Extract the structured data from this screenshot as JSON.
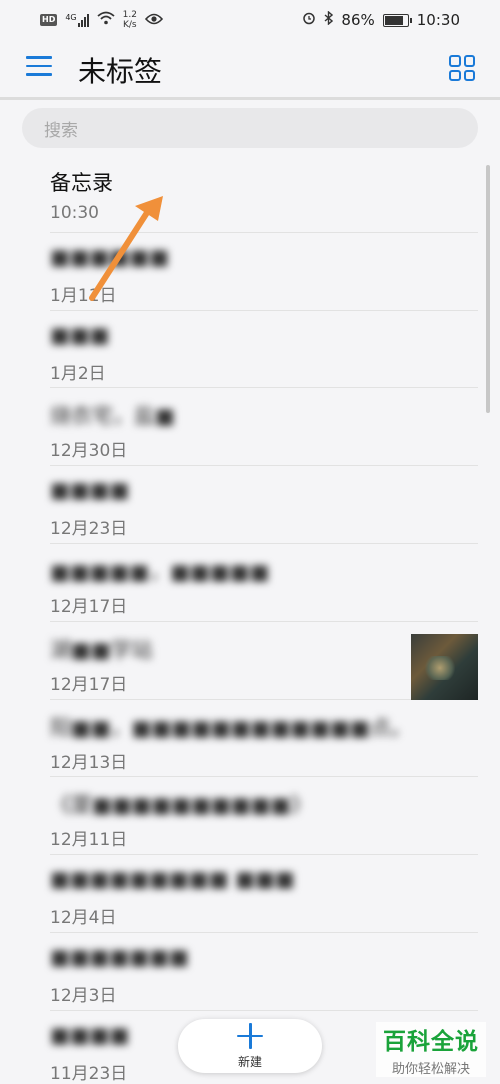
{
  "status_bar": {
    "hd": "HD",
    "signal_label": "4G",
    "net_speed_value": "1.2",
    "net_speed_unit": "K/s",
    "battery": "86%",
    "battery_level": 0.86,
    "time": "10:30"
  },
  "header": {
    "title": "未标签"
  },
  "search": {
    "placeholder": "搜索"
  },
  "notes": [
    {
      "title": "备忘录",
      "date": "10:30",
      "blurred": false,
      "has_image": false
    },
    {
      "title": "■■■■■■",
      "date": "1月11日",
      "blurred": true,
      "has_image": false
    },
    {
      "title": "■■■",
      "date": "1月2日",
      "blurred": true,
      "has_image": false
    },
    {
      "title": "烧衣宅，盐■",
      "date": "12月30日",
      "blurred": true,
      "has_image": false
    },
    {
      "title": "■■■■",
      "date": "12月23日",
      "blurred": true,
      "has_image": false
    },
    {
      "title": "■■■■■，■■■■■",
      "date": "12月17日",
      "blurred": true,
      "has_image": false
    },
    {
      "title": "湖■■学站",
      "date": "12月17日",
      "blurred": true,
      "has_image": true
    },
    {
      "title": "阳■■，■■■■■■■■■■■■点。",
      "date": "12月13日",
      "blurred": true,
      "has_image": false
    },
    {
      "title": "《厦■■■■■■■■■■》",
      "date": "12月11日",
      "blurred": true,
      "has_image": false
    },
    {
      "title": "■■■■■■■■■ ■■■",
      "date": "12月4日",
      "blurred": true,
      "has_image": false
    },
    {
      "title": "■■■■■■■",
      "date": "12月3日",
      "blurred": true,
      "has_image": false
    },
    {
      "title": "■■■■",
      "date": "11月23日",
      "blurred": true,
      "has_image": false
    }
  ],
  "fab": {
    "label": "新建"
  },
  "watermark": {
    "main": "百科全说",
    "sub": "助你轻松解决"
  },
  "colors": {
    "accent": "#1a7ad8",
    "annotation_arrow": "#f0903a",
    "watermark_green": "#1aa33a"
  }
}
